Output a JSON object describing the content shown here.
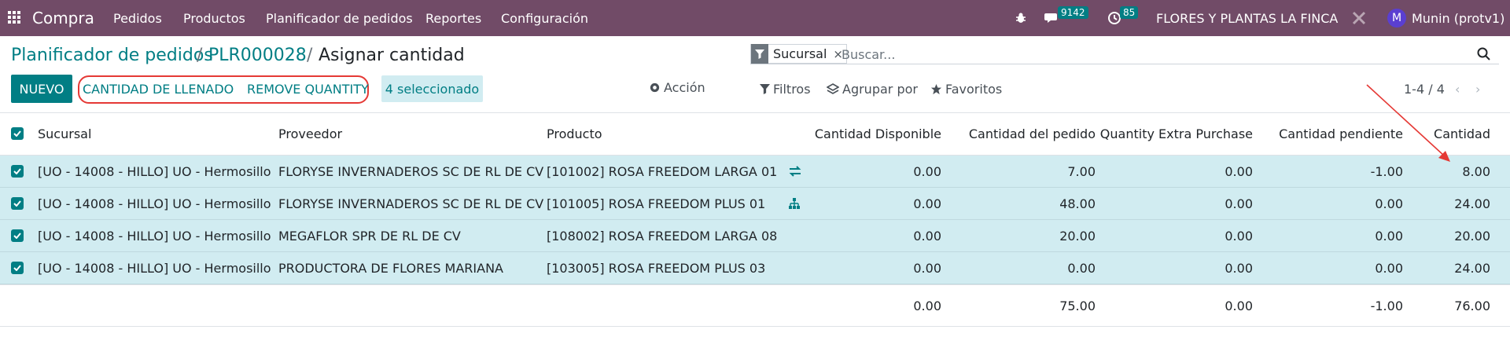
{
  "navbar": {
    "app_name": "Compra",
    "menu": [
      "Pedidos",
      "Productos",
      "Planificador de pedidos",
      "Reportes",
      "Configuración"
    ],
    "messages_count": "9142",
    "activities_count": "85",
    "company": "FLORES Y PLANTAS LA FINCA",
    "user_initial": "M",
    "user_name": "Munin (protv1)"
  },
  "breadcrumb": {
    "items": [
      "Planificador de pedidos",
      "PLR000028",
      "Asignar cantidad"
    ],
    "separator": "/"
  },
  "search": {
    "facet_label": "Sucursal",
    "facet_remove": "×",
    "placeholder": "Buscar..."
  },
  "toolbar": {
    "new_label": "NUEVO",
    "fill_label": "CANTIDAD DE LLENADO",
    "remove_label": "REMOVE QUANTITY",
    "selected_label": "4 seleccionado",
    "action_label": "Acción",
    "filters_label": "Filtros",
    "group_label": "Agrupar por",
    "favorites_label": "Favoritos"
  },
  "pager": {
    "value": "1-4 / 4",
    "prev": "‹",
    "next": "›"
  },
  "table": {
    "headers": [
      "Sucursal",
      "Proveedor",
      "Producto",
      "Cantidad Disponible",
      "Cantidad del pedido",
      "Quantity Extra Purchase",
      "Cantidad pendiente",
      "Cantidad"
    ],
    "rows": [
      {
        "sucursal": "[UO - 14008 - HILLO] UO - Hermosillo",
        "proveedor": "FLORYSE INVERNADEROS SC DE RL DE CV",
        "producto": "[101002] ROSA FREEDOM LARGA 01",
        "icon": "transfer-icon",
        "disponible": "0.00",
        "pedido": "7.00",
        "extra": "0.00",
        "pendiente": "-1.00",
        "cantidad": "8.00"
      },
      {
        "sucursal": "[UO - 14008 - HILLO] UO - Hermosillo",
        "proveedor": "FLORYSE INVERNADEROS SC DE RL DE CV",
        "producto": "[101005] ROSA FREEDOM PLUS 01",
        "icon": "sitemap-icon",
        "disponible": "0.00",
        "pedido": "48.00",
        "extra": "0.00",
        "pendiente": "0.00",
        "cantidad": "24.00"
      },
      {
        "sucursal": "[UO - 14008 - HILLO] UO - Hermosillo",
        "proveedor": "MEGAFLOR SPR DE RL DE CV",
        "producto": "[108002] ROSA FREEDOM LARGA 08",
        "icon": "",
        "disponible": "0.00",
        "pedido": "20.00",
        "extra": "0.00",
        "pendiente": "0.00",
        "cantidad": "20.00"
      },
      {
        "sucursal": "[UO - 14008 - HILLO] UO - Hermosillo",
        "proveedor": "PRODUCTORA DE FLORES MARIANA",
        "producto": "[103005] ROSA FREEDOM PLUS 03",
        "icon": "",
        "disponible": "0.00",
        "pedido": "0.00",
        "extra": "0.00",
        "pendiente": "0.00",
        "cantidad": "24.00"
      }
    ],
    "totals": {
      "disponible": "0.00",
      "pedido": "75.00",
      "extra": "0.00",
      "pendiente": "-1.00",
      "cantidad": "76.00"
    }
  },
  "colors": {
    "navbar": "#714b67",
    "primary": "#017e84",
    "selected_row": "#d1ecf1",
    "annotation": "#e53935"
  }
}
